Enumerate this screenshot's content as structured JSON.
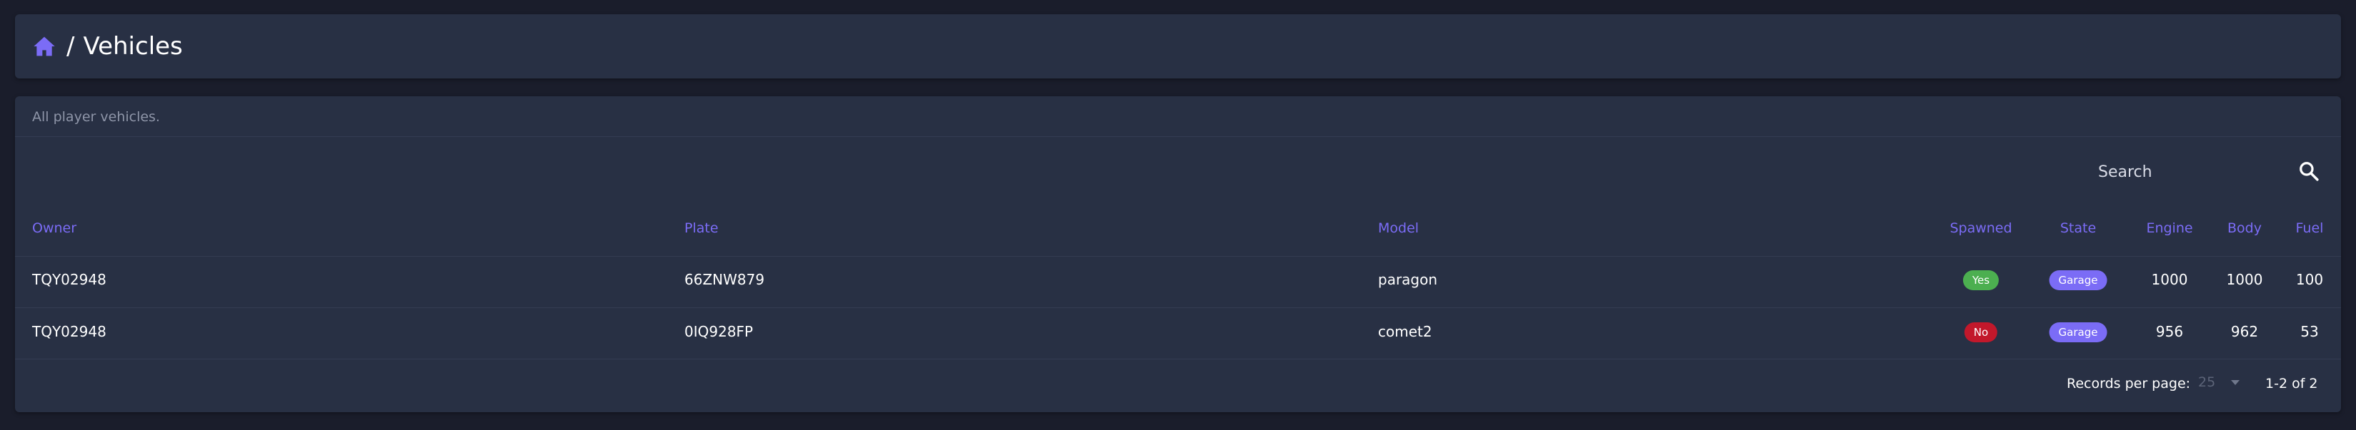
{
  "header": {
    "separator": "/",
    "title": "Vehicles"
  },
  "card": {
    "subtitle": "All player vehicles."
  },
  "search": {
    "placeholder": "Search",
    "value": ""
  },
  "table": {
    "columns": {
      "owner": "Owner",
      "plate": "Plate",
      "model": "Model",
      "spawned": "Spawned",
      "state": "State",
      "engine": "Engine",
      "body": "Body",
      "fuel": "Fuel"
    },
    "rows": [
      {
        "owner": "TQY02948",
        "plate": "66ZNW879",
        "model": "paragon",
        "spawned": "Yes",
        "state": "Garage",
        "engine": "1000",
        "body": "1000",
        "fuel": "100"
      },
      {
        "owner": "TQY02948",
        "plate": "0IQ928FP",
        "model": "comet2",
        "spawned": "No",
        "state": "Garage",
        "engine": "956",
        "body": "962",
        "fuel": "53"
      }
    ]
  },
  "footer": {
    "records_label": "Records per page:",
    "per_page": "25",
    "range": "1-2 of 2"
  },
  "colors": {
    "accent": "#7b6cf6",
    "spawned_yes": "#4caf50",
    "spawned_no": "#c2182b",
    "state_badge": "#7b6cf6"
  },
  "icons": {
    "home": "home-icon",
    "search": "search-icon",
    "dropdown": "chevron-down-icon"
  }
}
